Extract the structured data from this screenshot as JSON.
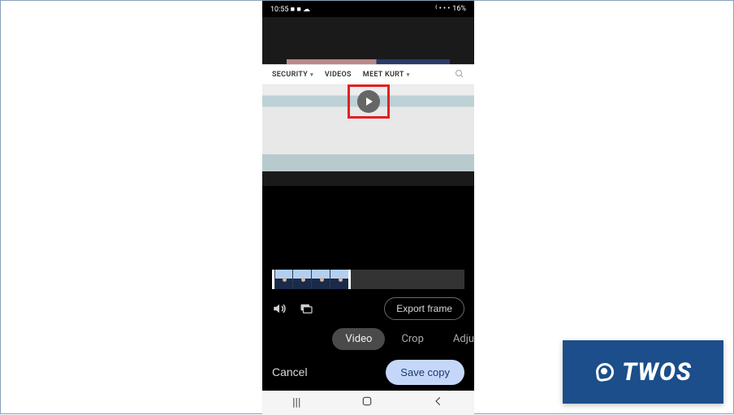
{
  "statusbar": {
    "time": "10:55",
    "left_icons": "■ ■ ☁",
    "right_icons": "⁽ • • •",
    "battery_pct": "16%"
  },
  "webnav": {
    "item1": "SECURITY",
    "item2": "VIDEOS",
    "item3": "MEET KURT",
    "search_icon": "search"
  },
  "play": {
    "icon": "play"
  },
  "controls": {
    "mute_icon": "volume",
    "frame_icon": "frame-snapshot",
    "export_label": "Export frame"
  },
  "tabs": {
    "t1": "Video",
    "t2": "Crop",
    "t3": "Adju"
  },
  "bottombar": {
    "cancel": "Cancel",
    "save": "Save copy"
  },
  "navbar": {
    "recents": "|||",
    "home": "▢",
    "back": "‹"
  },
  "watermark": {
    "text": "TWOS"
  }
}
